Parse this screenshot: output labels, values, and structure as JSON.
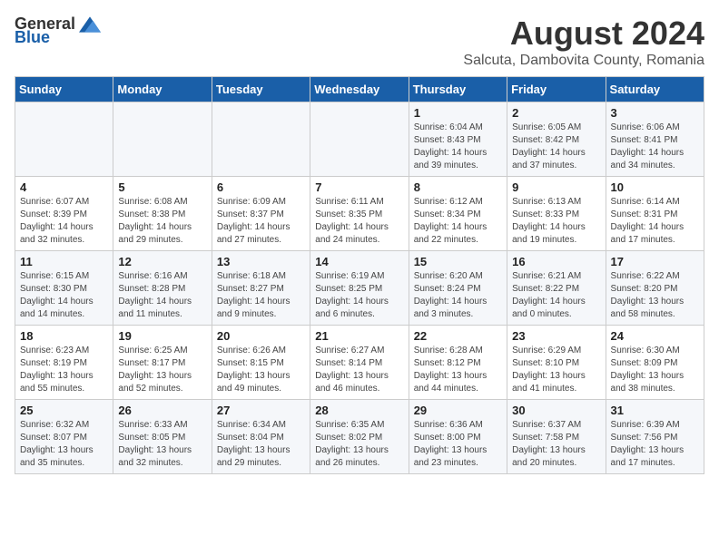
{
  "header": {
    "logo_general": "General",
    "logo_blue": "Blue",
    "title": "August 2024",
    "subtitle": "Salcuta, Dambovita County, Romania"
  },
  "days_of_week": [
    "Sunday",
    "Monday",
    "Tuesday",
    "Wednesday",
    "Thursday",
    "Friday",
    "Saturday"
  ],
  "weeks": [
    [
      {
        "day": "",
        "info": ""
      },
      {
        "day": "",
        "info": ""
      },
      {
        "day": "",
        "info": ""
      },
      {
        "day": "",
        "info": ""
      },
      {
        "day": "1",
        "info": "Sunrise: 6:04 AM\nSunset: 8:43 PM\nDaylight: 14 hours\nand 39 minutes."
      },
      {
        "day": "2",
        "info": "Sunrise: 6:05 AM\nSunset: 8:42 PM\nDaylight: 14 hours\nand 37 minutes."
      },
      {
        "day": "3",
        "info": "Sunrise: 6:06 AM\nSunset: 8:41 PM\nDaylight: 14 hours\nand 34 minutes."
      }
    ],
    [
      {
        "day": "4",
        "info": "Sunrise: 6:07 AM\nSunset: 8:39 PM\nDaylight: 14 hours\nand 32 minutes."
      },
      {
        "day": "5",
        "info": "Sunrise: 6:08 AM\nSunset: 8:38 PM\nDaylight: 14 hours\nand 29 minutes."
      },
      {
        "day": "6",
        "info": "Sunrise: 6:09 AM\nSunset: 8:37 PM\nDaylight: 14 hours\nand 27 minutes."
      },
      {
        "day": "7",
        "info": "Sunrise: 6:11 AM\nSunset: 8:35 PM\nDaylight: 14 hours\nand 24 minutes."
      },
      {
        "day": "8",
        "info": "Sunrise: 6:12 AM\nSunset: 8:34 PM\nDaylight: 14 hours\nand 22 minutes."
      },
      {
        "day": "9",
        "info": "Sunrise: 6:13 AM\nSunset: 8:33 PM\nDaylight: 14 hours\nand 19 minutes."
      },
      {
        "day": "10",
        "info": "Sunrise: 6:14 AM\nSunset: 8:31 PM\nDaylight: 14 hours\nand 17 minutes."
      }
    ],
    [
      {
        "day": "11",
        "info": "Sunrise: 6:15 AM\nSunset: 8:30 PM\nDaylight: 14 hours\nand 14 minutes."
      },
      {
        "day": "12",
        "info": "Sunrise: 6:16 AM\nSunset: 8:28 PM\nDaylight: 14 hours\nand 11 minutes."
      },
      {
        "day": "13",
        "info": "Sunrise: 6:18 AM\nSunset: 8:27 PM\nDaylight: 14 hours\nand 9 minutes."
      },
      {
        "day": "14",
        "info": "Sunrise: 6:19 AM\nSunset: 8:25 PM\nDaylight: 14 hours\nand 6 minutes."
      },
      {
        "day": "15",
        "info": "Sunrise: 6:20 AM\nSunset: 8:24 PM\nDaylight: 14 hours\nand 3 minutes."
      },
      {
        "day": "16",
        "info": "Sunrise: 6:21 AM\nSunset: 8:22 PM\nDaylight: 14 hours\nand 0 minutes."
      },
      {
        "day": "17",
        "info": "Sunrise: 6:22 AM\nSunset: 8:20 PM\nDaylight: 13 hours\nand 58 minutes."
      }
    ],
    [
      {
        "day": "18",
        "info": "Sunrise: 6:23 AM\nSunset: 8:19 PM\nDaylight: 13 hours\nand 55 minutes."
      },
      {
        "day": "19",
        "info": "Sunrise: 6:25 AM\nSunset: 8:17 PM\nDaylight: 13 hours\nand 52 minutes."
      },
      {
        "day": "20",
        "info": "Sunrise: 6:26 AM\nSunset: 8:15 PM\nDaylight: 13 hours\nand 49 minutes."
      },
      {
        "day": "21",
        "info": "Sunrise: 6:27 AM\nSunset: 8:14 PM\nDaylight: 13 hours\nand 46 minutes."
      },
      {
        "day": "22",
        "info": "Sunrise: 6:28 AM\nSunset: 8:12 PM\nDaylight: 13 hours\nand 44 minutes."
      },
      {
        "day": "23",
        "info": "Sunrise: 6:29 AM\nSunset: 8:10 PM\nDaylight: 13 hours\nand 41 minutes."
      },
      {
        "day": "24",
        "info": "Sunrise: 6:30 AM\nSunset: 8:09 PM\nDaylight: 13 hours\nand 38 minutes."
      }
    ],
    [
      {
        "day": "25",
        "info": "Sunrise: 6:32 AM\nSunset: 8:07 PM\nDaylight: 13 hours\nand 35 minutes."
      },
      {
        "day": "26",
        "info": "Sunrise: 6:33 AM\nSunset: 8:05 PM\nDaylight: 13 hours\nand 32 minutes."
      },
      {
        "day": "27",
        "info": "Sunrise: 6:34 AM\nSunset: 8:04 PM\nDaylight: 13 hours\nand 29 minutes."
      },
      {
        "day": "28",
        "info": "Sunrise: 6:35 AM\nSunset: 8:02 PM\nDaylight: 13 hours\nand 26 minutes."
      },
      {
        "day": "29",
        "info": "Sunrise: 6:36 AM\nSunset: 8:00 PM\nDaylight: 13 hours\nand 23 minutes."
      },
      {
        "day": "30",
        "info": "Sunrise: 6:37 AM\nSunset: 7:58 PM\nDaylight: 13 hours\nand 20 minutes."
      },
      {
        "day": "31",
        "info": "Sunrise: 6:39 AM\nSunset: 7:56 PM\nDaylight: 13 hours\nand 17 minutes."
      }
    ]
  ]
}
